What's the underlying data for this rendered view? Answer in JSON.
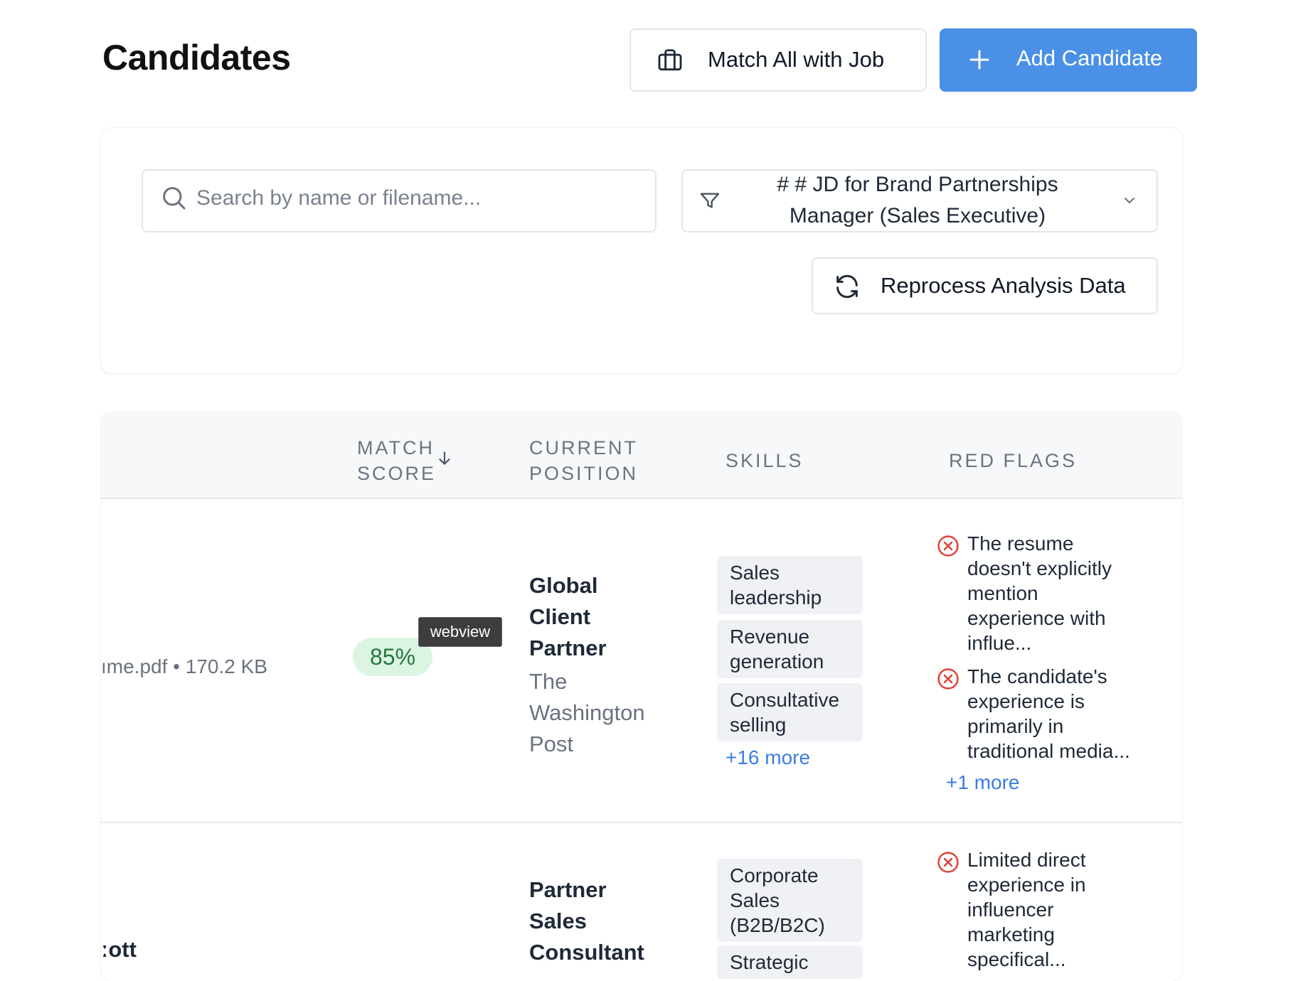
{
  "header": {
    "title": "Candidates",
    "match_all_label": "Match All with Job",
    "add_candidate_label": "Add Candidate"
  },
  "filters": {
    "search_placeholder": "Search by name or filename...",
    "job_select_value_line1": "# # JD for Brand Partnerships",
    "job_select_value_line2": "Manager (Sales Executive)",
    "reprocess_label": "Reprocess Analysis Data"
  },
  "table": {
    "columns": {
      "match_score_line1": "MATCH",
      "match_score_line2": "SCORE",
      "current_position_line1": "CURRENT",
      "current_position_line2": "POSITION",
      "skills": "SKILLS",
      "red_flags": "RED FLAGS"
    },
    "rows": [
      {
        "file_meta": "ıme.pdf • 170.2 KB",
        "match_score": "85%",
        "position_title": [
          "Global",
          "Client",
          "Partner"
        ],
        "company": [
          "The",
          "Washington",
          "Post"
        ],
        "skills": [
          "Sales leadership",
          "Revenue generation",
          "Consultative selling"
        ],
        "skills_more": "+16 more",
        "red_flags": [
          "The resume doesn't explicitly mention experience with influe...",
          "The candidate's experience is primarily in traditional media..."
        ],
        "red_flags_more": "+1 more"
      },
      {
        "name_partial": "ːott",
        "position_title": [
          "Partner",
          "Sales",
          "Consultant"
        ],
        "skills": [
          "Corporate Sales (B2B/B2C)",
          "Strategic"
        ],
        "red_flags": [
          "Limited direct experience in influencer marketing specifical..."
        ]
      }
    ]
  },
  "tooltip": "webview",
  "colors": {
    "primary": "#4a90e6",
    "score_bg": "#dcf5e3",
    "score_text": "#217a3c",
    "flag_red": "#e0463b",
    "link": "#3b7de0"
  }
}
